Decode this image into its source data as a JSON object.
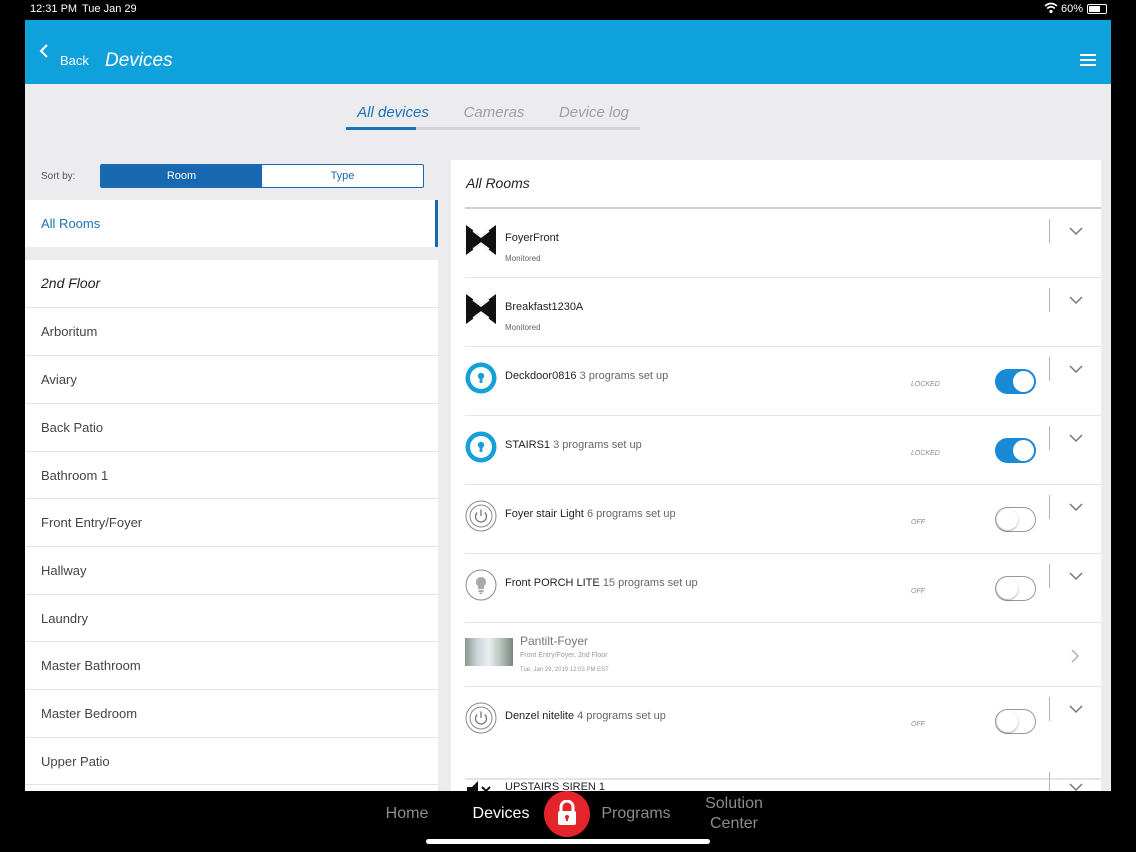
{
  "status_bar": {
    "time": "12:31 PM",
    "date": "Tue Jan 29",
    "battery": "60%"
  },
  "header": {
    "back_label": "Back",
    "title": "Devices"
  },
  "tabs": [
    {
      "label": "All devices",
      "active": true
    },
    {
      "label": "Cameras",
      "active": false
    },
    {
      "label": "Device log",
      "active": false
    }
  ],
  "sort": {
    "label": "Sort by:",
    "options": [
      "Room",
      "Type"
    ],
    "selected": "Room"
  },
  "sidebar": {
    "selected": "All Rooms",
    "group_heading": "2nd Floor",
    "rooms": [
      "Arboritum",
      "Aviary",
      "Back Patio",
      "Bathroom 1",
      "Front Entry/Foyer",
      "Hallway",
      "Laundry",
      "Master Bathroom",
      "Master Bedroom",
      "Upper Patio"
    ]
  },
  "panel": {
    "title": "All Rooms",
    "devices": [
      {
        "name": "FoyerFront",
        "programs": "",
        "sub": "Monitored",
        "state": "",
        "icon": "motion-sensor-icon",
        "toggle": null
      },
      {
        "name": "Breakfast1230A",
        "programs": "",
        "sub": "Monitored",
        "state": "",
        "icon": "motion-sensor-icon",
        "toggle": null
      },
      {
        "name": "Deckdoor0816",
        "programs": "3 programs set up",
        "sub": "",
        "state": "LOCKED",
        "icon": "lock-icon",
        "toggle": true
      },
      {
        "name": "STAIRS1",
        "programs": "3 programs set up",
        "sub": "",
        "state": "LOCKED",
        "icon": "lock-icon",
        "toggle": true
      },
      {
        "name": "Foyer stair Light",
        "programs": "6 programs set up",
        "sub": "",
        "state": "OFF",
        "icon": "power-switch-icon",
        "toggle": false
      },
      {
        "name": "Front PORCH LITE",
        "programs": "15 programs set up",
        "sub": "",
        "state": "OFF",
        "icon": "light-bulb-icon",
        "toggle": false
      }
    ],
    "camera": {
      "name": "Pantilt-Foyer",
      "location": "Front Entry/Foyer, 2nd Floor",
      "timestamp": "Tue, Jan 29, 2019 12:03 PM EST",
      "icon": "camera-thumbnail"
    },
    "devices_after": [
      {
        "name": "Denzel nitelite",
        "programs": "4 programs set up",
        "state": "OFF",
        "icon": "power-switch-icon",
        "toggle": false
      },
      {
        "name": "UPSTAIRS SIREN 1",
        "programs": "",
        "state": "",
        "icon": "siren-mute-icon",
        "toggle": null
      }
    ]
  },
  "nav": {
    "items": [
      "Home",
      "Devices",
      "Programs",
      "Solution Center"
    ],
    "active": "Devices",
    "center_icon": "lock-icon"
  },
  "colors": {
    "header": "#0ea1dc",
    "accent": "#1767b1",
    "toggle_on": "#1a8ad4",
    "alarm_button": "#e3242b"
  }
}
